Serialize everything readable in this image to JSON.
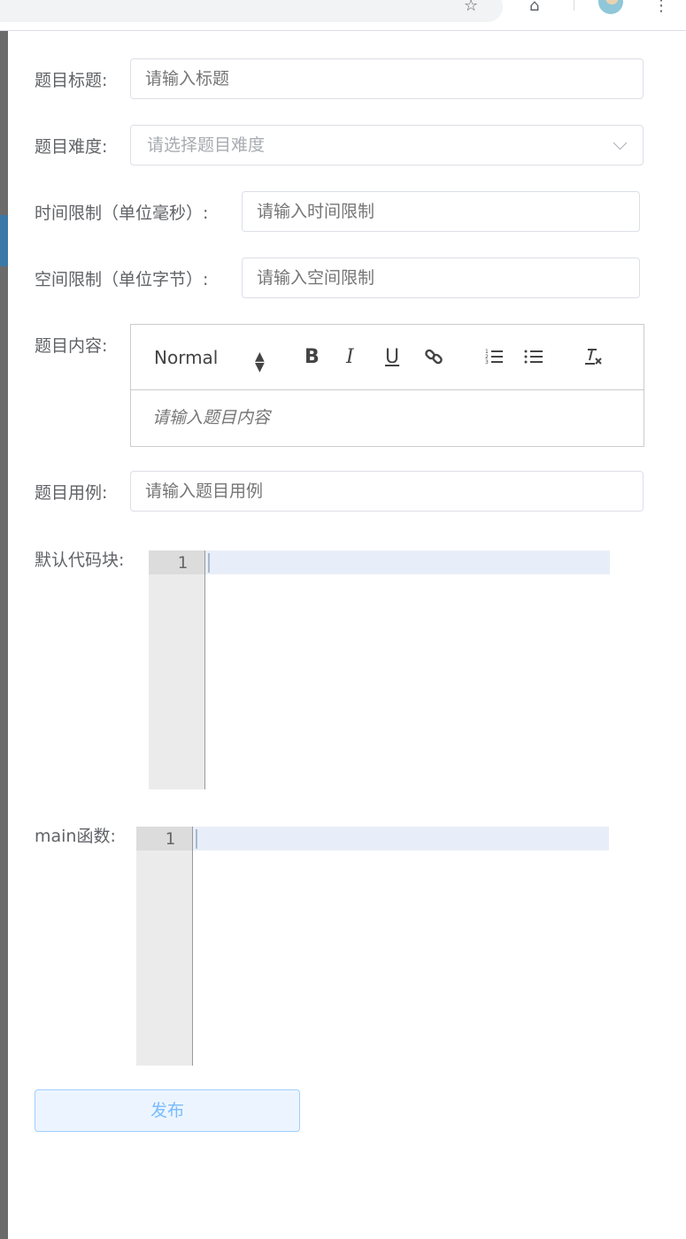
{
  "form": {
    "title": {
      "label": "题目标题:",
      "placeholder": "请输入标题"
    },
    "difficulty": {
      "label": "题目难度:",
      "placeholder": "请选择题目难度"
    },
    "time_limit": {
      "label": "时间限制（单位毫秒）:",
      "placeholder": "请输入时间限制"
    },
    "space_limit": {
      "label": "空间限制（单位字节）:",
      "placeholder": "请输入空间限制"
    },
    "content": {
      "label": "题目内容:",
      "format_select": "Normal",
      "placeholder": "请输入题目内容",
      "toolbar": [
        "bold",
        "italic",
        "underline",
        "link",
        "ordered-list",
        "bullet-list",
        "clear-format"
      ]
    },
    "example": {
      "label": "题目用例:",
      "placeholder": "请输入题目用例"
    },
    "default_code": {
      "label": "默认代码块:",
      "line_number": "1"
    },
    "main_function": {
      "label": "main函数:",
      "line_number": "1"
    },
    "submit": {
      "label": "发布"
    }
  },
  "colors": {
    "border": "#dcdfe6",
    "placeholder": "#a8abb2",
    "primary_light": "#79bbff",
    "primary_bg": "#ecf5ff",
    "active_line": "#e8eef9"
  }
}
